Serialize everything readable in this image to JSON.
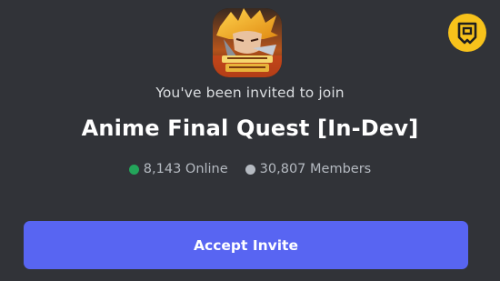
{
  "invite": {
    "subtitle": "You've been invited to join",
    "server_name": "Anime Final Quest [In-Dev]",
    "online": "8,143 Online",
    "members": "30,807 Members",
    "accept_label": "Accept Invite"
  },
  "server_icon": {
    "icon": "server-avatar-image",
    "logo_text": "ANIME FINAL"
  },
  "badge": {
    "icon": "site-logo-icon"
  },
  "colors": {
    "background": "#313338",
    "accent": "#5865f2",
    "online": "#23a55a",
    "members": "#b5bac1",
    "badge": "#f7c21b"
  }
}
